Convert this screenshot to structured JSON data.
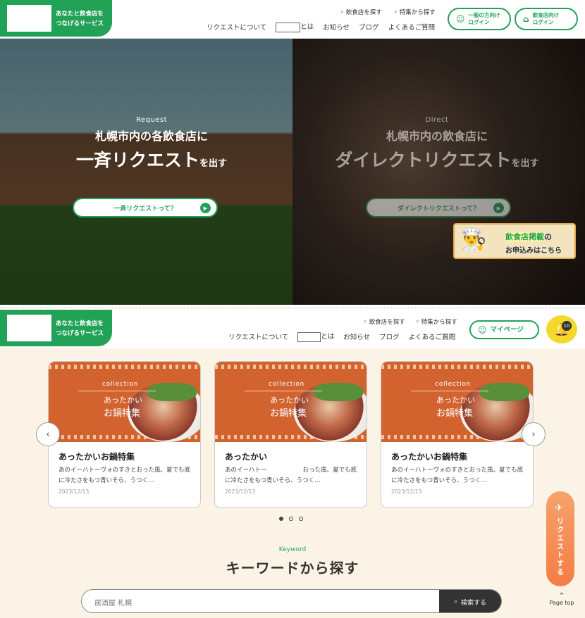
{
  "site": {
    "tagline": "あなたと飲食店を\nつなげるサービス"
  },
  "header1": {
    "sub_links": [
      {
        "label": "飲食店を探す"
      },
      {
        "label": "特集から探す"
      }
    ],
    "nav": [
      "リクエストについて",
      "とは",
      "お知らせ",
      "ブログ",
      "よくあるご質問"
    ],
    "btn_general": "一般の方向け\nログイン",
    "btn_restaurant": "飲食店向け\nログイン"
  },
  "hero": {
    "left": {
      "en": "Request",
      "line1": "札幌市内の各飲食店に",
      "line2": "一斉リクエスト",
      "suffix": "を出す",
      "cta": "一斉リクエストって？"
    },
    "right": {
      "en": "Direct",
      "line1": "札幌市内の飲食店に",
      "line2": "ダイレクトリクエスト",
      "suffix": "を出す",
      "cta": "ダイレクトリクエストって？"
    },
    "banner": {
      "highlight": "飲食店掲載",
      "rest": "の",
      "line2": "お申込みはこちら"
    }
  },
  "header2": {
    "sub_links": [
      {
        "label": "飲食店を探す"
      },
      {
        "label": "特集から探す"
      }
    ],
    "nav": [
      "リクエストについて",
      "とは",
      "お知らせ",
      "ブログ",
      "よくあるご質問"
    ],
    "mypage": "マイページ",
    "notif_count": "10"
  },
  "cards": [
    {
      "collection": "collection",
      "img_l1": "あったかい",
      "img_l2": "お鍋特集",
      "title": "あったかいお鍋特集",
      "desc": "あのイーハトーヴォのすきとおった風、夏でも底に冷たさをもつ青いそら、うつく…",
      "date": "2023/12/13"
    },
    {
      "collection": "collection",
      "img_l1": "あったかい",
      "img_l2": "お鍋特集",
      "title": "あったかい",
      "desc": "あのイーハト一　　　　　　おった風、夏でも底に冷たさをもつ青いそら、うつく…",
      "date": "2023/12/13"
    },
    {
      "collection": "collection",
      "img_l1": "あったかい",
      "img_l2": "お鍋特集",
      "title": "あったかいお鍋特集",
      "desc": "あのイーハトーヴォのすきとおった風、夏でも底に冷たさをもつ青いそら、うつく…",
      "date": "2023/12/13"
    }
  ],
  "keyword": {
    "en": "Keyword",
    "title": "キーワードから探す",
    "placeholder": "居酒屋 札幌",
    "button": "検索する"
  },
  "floating": {
    "request": "リクエストする",
    "page_top": "Page top"
  },
  "colors": {
    "brand": "#22a257",
    "accent": "#f57c45",
    "bg_cream": "#fbf4e6"
  }
}
